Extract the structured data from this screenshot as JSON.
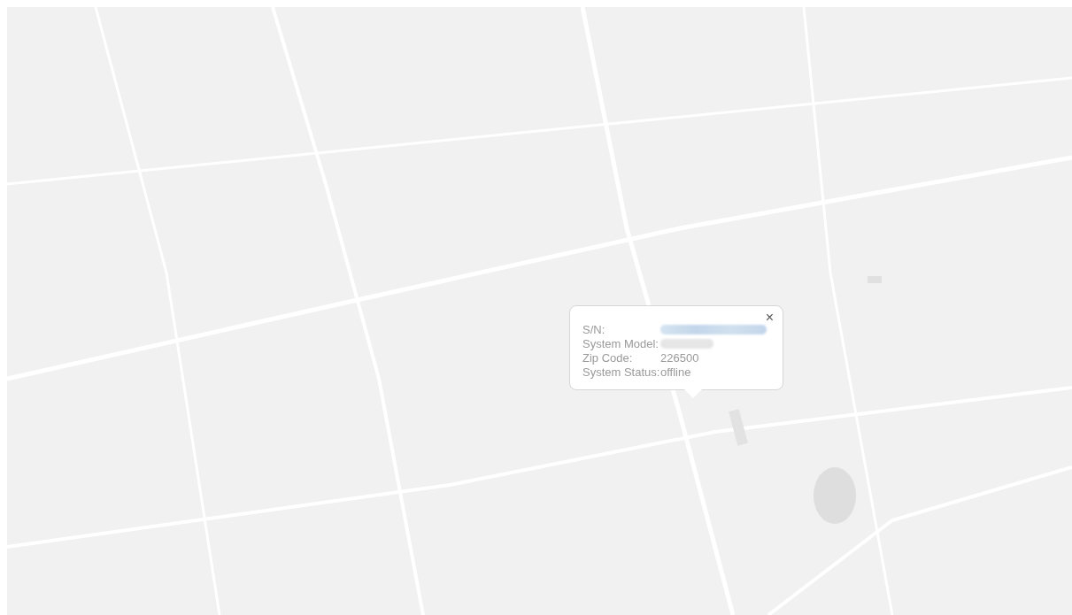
{
  "info_window": {
    "close": "×",
    "fields": [
      {
        "label": "S/N:",
        "kind": "redacted"
      },
      {
        "label": "System Model:",
        "kind": "redacted"
      },
      {
        "label": "Zip Code:",
        "kind": "text",
        "value": "226500"
      },
      {
        "label": "System Status:",
        "kind": "text",
        "value": "offline"
      }
    ]
  }
}
